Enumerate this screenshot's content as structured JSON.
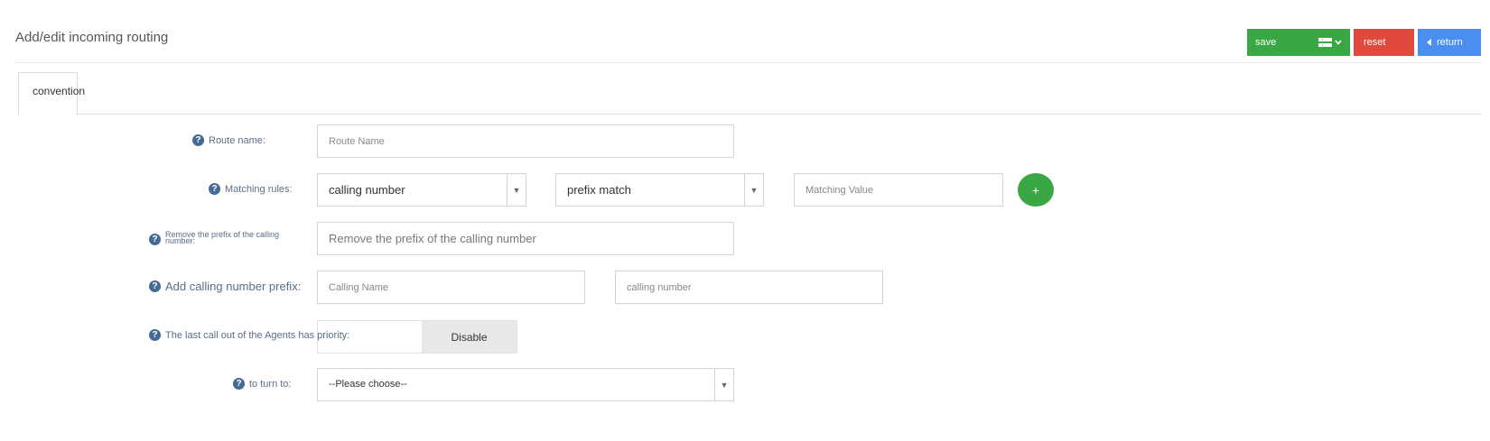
{
  "header": {
    "title": "Add/edit incoming routing"
  },
  "toolbar": {
    "save_label": "save",
    "reset_label": "reset",
    "return_label": "return",
    "colors": {
      "save": "#3aa745",
      "reset": "#e04a3c",
      "return": "#4a8ff0"
    }
  },
  "tabs": [
    {
      "label": "convention",
      "active": true
    }
  ],
  "form": {
    "route_name": {
      "label": "Route name:",
      "placeholder": "Route Name"
    },
    "matching_rules": {
      "label": "Matching rules:",
      "field_select": "calling number",
      "match_select": "prefix match",
      "value_placeholder": "Matching Value",
      "add_label": "+"
    },
    "remove_prefix": {
      "label": "Remove the prefix of the calling number:",
      "placeholder": "Remove the prefix of the calling number"
    },
    "add_prefix": {
      "label": "Add calling number prefix:",
      "name_placeholder": "Calling Name",
      "number_placeholder": "calling number"
    },
    "agent_priority": {
      "label": "The last call out of the Agents has priority:",
      "toggle_value": "Disable"
    },
    "turn_to": {
      "label": "to turn to:",
      "selected": "--Please choose--"
    }
  },
  "icons": {
    "help": "question-circle-icon",
    "save_menu": "list-dropdown-icon",
    "return": "caret-left-icon",
    "select_arrow": "triangle-down-icon"
  }
}
